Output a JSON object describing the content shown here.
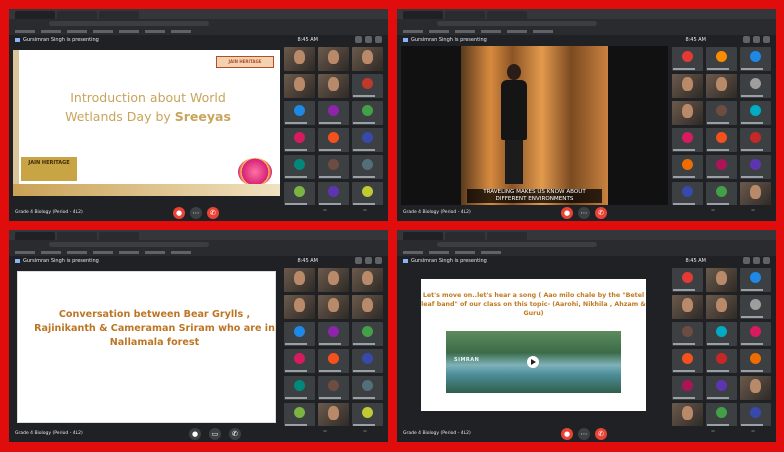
{
  "panels": [
    {
      "presenting": "Gursimran Singh is presenting",
      "clock": "8:45 AM",
      "meeting": "Grade 4 Biology (Period - 4L2)",
      "slide": {
        "title_plain": "Introduction about World Wetlands Day by ",
        "title_bold": "Sreeyas",
        "school_logo": "JAIN HERITAGE",
        "corner_logo": "JAIN HERITAGE"
      }
    },
    {
      "presenting": "Gursimran Singh is presenting",
      "clock": "8:45 AM",
      "meeting": "Grade 4 Biology (Period - 4L2)",
      "caption": "TRAVELING MAKES US KNOW ABOUT DIFFERENT ENVIRONMENTS"
    },
    {
      "presenting": "Gursimran Singh is presenting",
      "clock": "8:45 AM",
      "meeting": "Grade 4 Biology (Period - 4L2)",
      "slide_text": "Conversation between Bear Grylls , Rajinikanth & Cameraman Sriram who are in Nallamala forest"
    },
    {
      "presenting": "Gursimran Singh is presenting",
      "clock": "8:45 AM",
      "meeting": "Grade 4 Biology (Period - 4L2)",
      "slide_text": "Let's move on..let's hear a song ( Aao milo chale by the \"Betel leaf band\" of our class on this topic- (Aarohi, Nikhila , Ahzam & Guru)",
      "video_title": "SIMRAN"
    }
  ],
  "controls": {
    "mic_icon": "mic-off-icon",
    "cam_icon": "camera-off-icon",
    "hangup_icon": "hangup-icon"
  },
  "colors": {
    "frame": "#e10d0d",
    "meet_bg": "#202124",
    "tile": "#3c4043",
    "danger": "#ea4335",
    "slide_gold": "#c9a45a"
  }
}
